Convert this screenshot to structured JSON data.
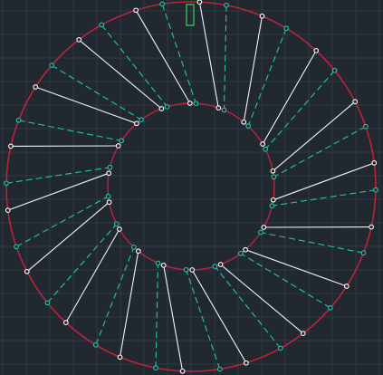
{
  "canvas": {
    "background": "#212830",
    "grid_color": "#2f3944",
    "grid": true
  },
  "geometry": {
    "ring_color": "#b8243c",
    "solid_line_color": "#f2f5f8",
    "dashed_line_color": "#20c7a8",
    "node_fill": "#212830",
    "solid_node_stroke": "#ffffff",
    "dashed_node_stroke": "#20c7a8",
    "marker_color": "#2ebf58",
    "pairs": 18,
    "outer_circle": true,
    "inner_circle": true
  }
}
